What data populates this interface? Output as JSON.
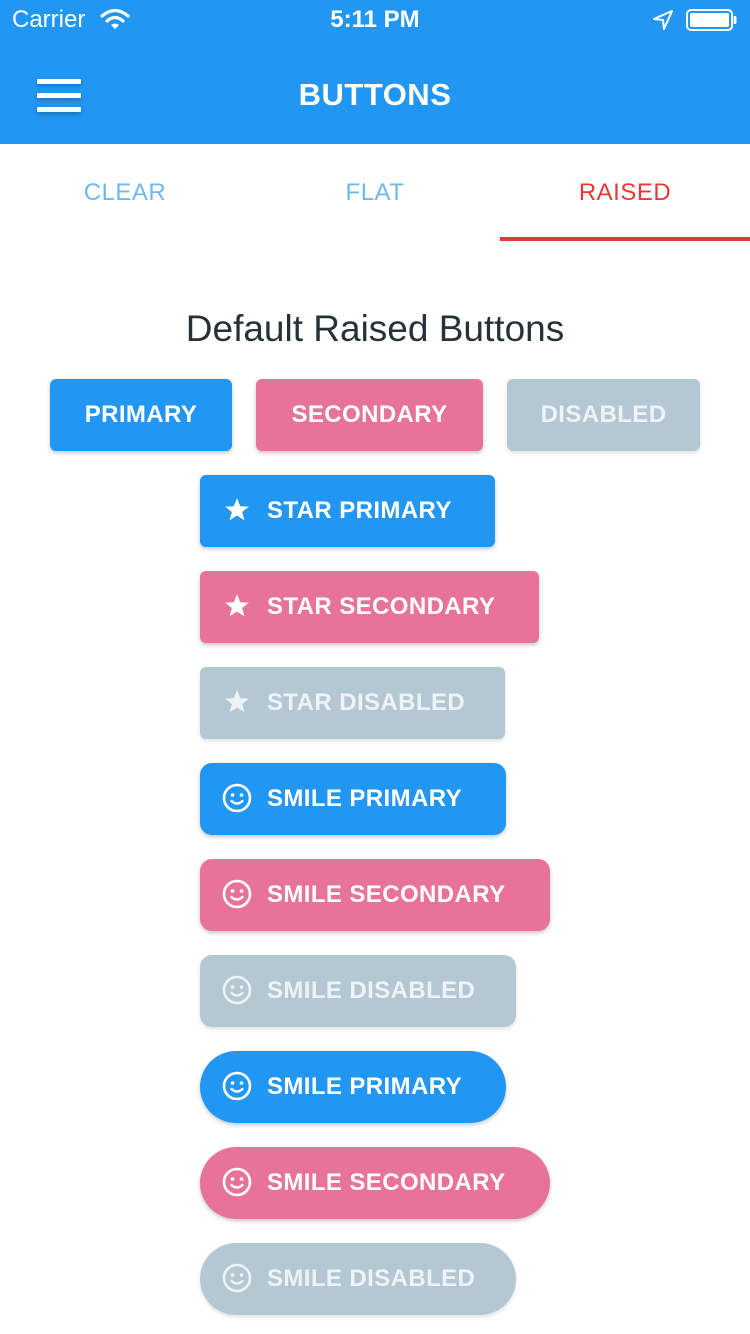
{
  "status_bar": {
    "carrier": "Carrier",
    "time": "5:11 PM",
    "icons": [
      "wifi-icon",
      "location-arrow-icon",
      "battery-icon"
    ]
  },
  "navbar": {
    "title": "BUTTONS",
    "menu_icon": "hamburger-menu-icon"
  },
  "tabs": [
    {
      "label": "CLEAR",
      "active": false
    },
    {
      "label": "FLAT",
      "active": false
    },
    {
      "label": "RAISED",
      "active": true
    }
  ],
  "section": {
    "title": "Default Raised Buttons"
  },
  "row_buttons": [
    {
      "label": "PRIMARY",
      "variant": "primary"
    },
    {
      "label": "SECONDARY",
      "variant": "secondary"
    },
    {
      "label": "DISABLED",
      "variant": "disabled"
    }
  ],
  "icon_buttons": [
    {
      "label": "STAR PRIMARY",
      "icon": "star-icon",
      "variant": "primary",
      "shape": "rounded"
    },
    {
      "label": "STAR SECONDARY",
      "icon": "star-icon",
      "variant": "secondary",
      "shape": "rounded"
    },
    {
      "label": "STAR DISABLED",
      "icon": "star-icon",
      "variant": "disabled",
      "shape": "rounded"
    },
    {
      "label": "SMILE PRIMARY",
      "icon": "smile-icon",
      "variant": "primary",
      "shape": "rounded"
    },
    {
      "label": "SMILE SECONDARY",
      "icon": "smile-icon",
      "variant": "secondary",
      "shape": "rounded"
    },
    {
      "label": "SMILE DISABLED",
      "icon": "smile-icon",
      "variant": "disabled",
      "shape": "rounded"
    },
    {
      "label": "SMILE PRIMARY",
      "icon": "smile-icon",
      "variant": "primary",
      "shape": "pill"
    },
    {
      "label": "SMILE SECONDARY",
      "icon": "smile-icon",
      "variant": "secondary",
      "shape": "pill"
    },
    {
      "label": "SMILE DISABLED",
      "icon": "smile-icon",
      "variant": "disabled",
      "shape": "pill"
    }
  ],
  "colors": {
    "primary": "#2196F3",
    "secondary": "#E8739A",
    "disabled": "#B4C8D3",
    "tab_active": "#E53935",
    "tab_inactive": "#6FB8F0"
  }
}
